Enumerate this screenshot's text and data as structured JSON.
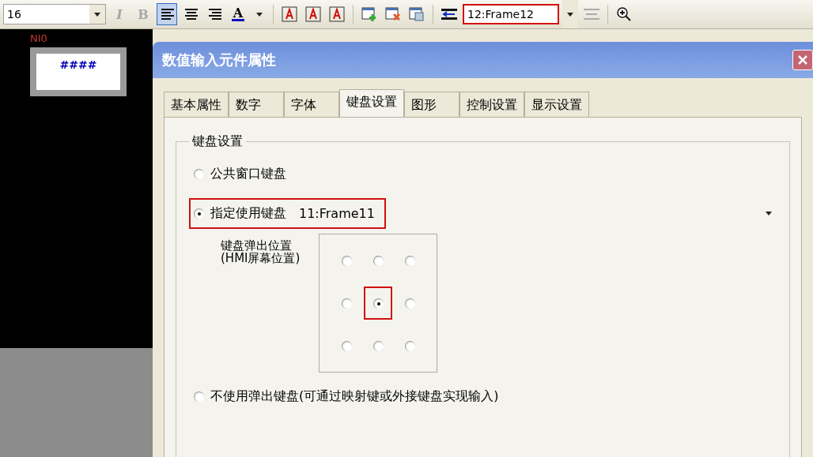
{
  "toolbar": {
    "font_size": "16",
    "text_buttons": [
      {
        "kind": "italic",
        "label": "I",
        "disabled": true
      },
      {
        "kind": "bold",
        "label": "B",
        "disabled": true
      }
    ],
    "align_buttons": [
      {
        "kind": "left",
        "selected": true
      },
      {
        "kind": "center",
        "selected": false
      },
      {
        "kind": "right",
        "selected": false
      }
    ],
    "font_color_label": "A",
    "frame_select": {
      "value": "12:Frame12",
      "highlighted": true
    }
  },
  "canvas": {
    "label": "NI0",
    "display_value": "####"
  },
  "dialog": {
    "title": "数值输入元件属性",
    "tabs": [
      {
        "label": "基本属性",
        "selected": false
      },
      {
        "label": "数字",
        "selected": false
      },
      {
        "label": "字体",
        "selected": false
      },
      {
        "label": "键盘设置",
        "selected": true
      },
      {
        "label": "图形",
        "selected": false
      },
      {
        "label": "控制设置",
        "selected": false
      },
      {
        "label": "显示设置",
        "selected": false
      }
    ],
    "group_title": "键盘设置",
    "options": [
      {
        "label": "公共窗口键盘",
        "selected": false,
        "highlighted": false
      },
      {
        "label": "指定使用键盘",
        "selected": true,
        "highlighted": true,
        "keyboard_value": "11:Frame11"
      },
      {
        "label": "不使用弹出键盘(可通过映射键或外接键盘实现输入)",
        "selected": false,
        "highlighted": false
      }
    ],
    "position_label": [
      "键盘弹出位置",
      "(HMI屏幕位置)"
    ],
    "positions": [
      {
        "selected": false,
        "highlighted": false
      },
      {
        "selected": false,
        "highlighted": false
      },
      {
        "selected": false,
        "highlighted": false
      },
      {
        "selected": false,
        "highlighted": false
      },
      {
        "selected": true,
        "highlighted": true
      },
      {
        "selected": false,
        "highlighted": false
      },
      {
        "selected": false,
        "highlighted": false
      },
      {
        "selected": false,
        "highlighted": false
      },
      {
        "selected": false,
        "highlighted": false
      }
    ]
  }
}
